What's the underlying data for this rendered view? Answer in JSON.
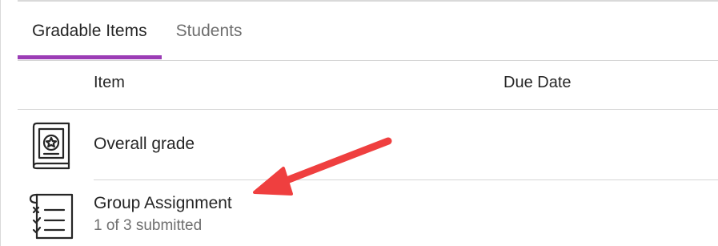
{
  "tabs": [
    {
      "label": "Gradable Items",
      "active": true
    },
    {
      "label": "Students",
      "active": false
    }
  ],
  "columns": {
    "item": "Item",
    "due_date": "Due Date"
  },
  "rows": [
    {
      "title": "Overall grade",
      "icon": "gradebook-book-icon",
      "subtitle": ""
    },
    {
      "title": "Group Assignment",
      "icon": "assignment-checklist-icon",
      "subtitle": "1 of 3 submitted"
    }
  ],
  "annotation": {
    "icon": "red-arrow",
    "color": "#ef3f3f"
  },
  "colors": {
    "accent": "#9b3cb5",
    "divider": "#d6d6d6",
    "muted_text": "#6f6f6f"
  }
}
